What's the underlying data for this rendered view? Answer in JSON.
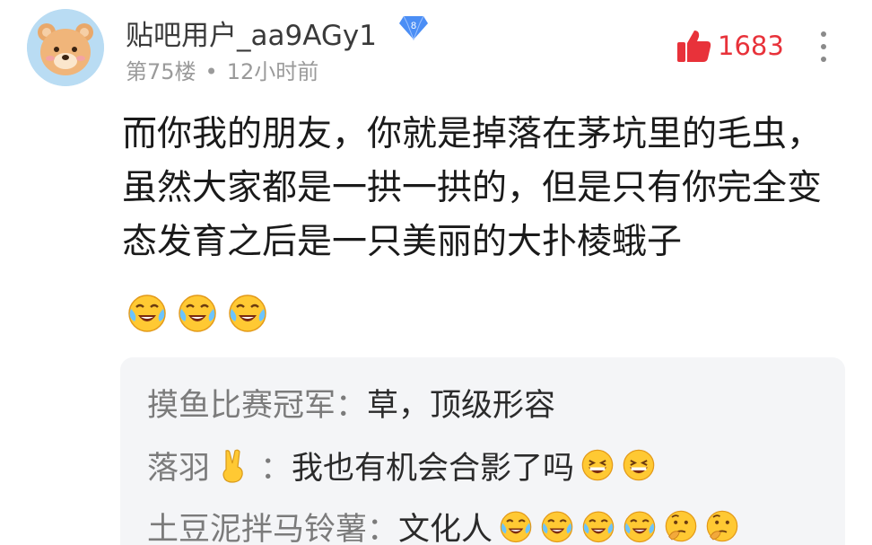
{
  "post": {
    "username": "贴吧用户_aa9AGy1",
    "level": "8",
    "floor": "第75楼",
    "separator": "•",
    "time": "12小时前",
    "like_count": "1683",
    "content": "而你我的朋友，你就是掉落在茅坑里的毛虫，虽然大家都是一拱一拱的，但是只有你完全变态发育之后是一只美丽的大扑棱蛾子",
    "emojis": [
      "crying-laugh-emoji",
      "crying-laugh-emoji",
      "crying-laugh-emoji"
    ]
  },
  "replies": [
    {
      "name": "摸鱼比赛冠军",
      "colon": "：",
      "text": "草，顶级形容",
      "emojis": []
    },
    {
      "name": "落羽",
      "name_emoji": "victory-hand-emoji",
      "colon": "：",
      "text": "我也有机会合影了吗",
      "emojis": [
        "grinning-emoji",
        "grinning-emoji"
      ]
    },
    {
      "name": "土豆泥拌马铃薯",
      "colon": "：",
      "text": "文化人",
      "emojis": [
        "crying-laugh-emoji",
        "crying-laugh-emoji",
        "crying-laugh-emoji",
        "crying-laugh-emoji",
        "thinking-emoji",
        "thinking-emoji"
      ]
    }
  ],
  "colors": {
    "like_red": "#e8323a",
    "badge_blue": "#4b8ef5",
    "reply_bg": "#f4f5f7"
  }
}
